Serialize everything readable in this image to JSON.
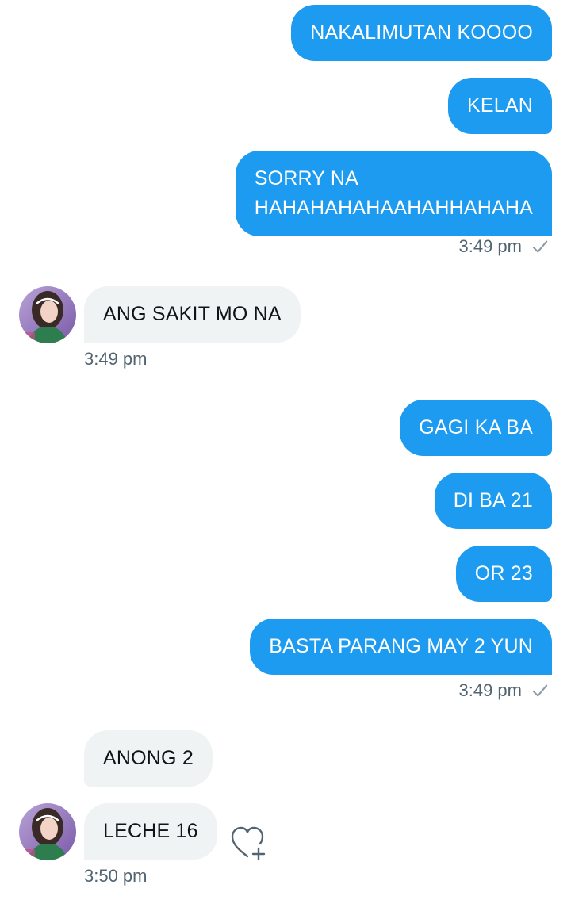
{
  "conversation": {
    "sent_group_1": {
      "messages": [
        "NAKALIMUTAN KOOOO",
        "KELAN",
        "SORRY NA",
        "HAHAHAHAHAAHAHHAHAHA"
      ],
      "timestamp": "3:49 pm",
      "status_icon": "check-icon"
    },
    "recv_group_1": {
      "messages": [
        "ANG SAKIT MO NA"
      ],
      "timestamp": "3:49 pm",
      "avatar_icon": "contact-avatar"
    },
    "sent_group_2": {
      "messages": [
        "GAGI KA BA",
        "DI BA 21",
        "OR 23",
        "BASTA PARANG MAY 2 YUN"
      ],
      "timestamp": "3:49 pm",
      "status_icon": "check-icon"
    },
    "recv_group_2": {
      "messages": [
        "ANONG 2",
        "LECHE 16"
      ],
      "timestamp": "3:50 pm",
      "avatar_icon": "contact-avatar",
      "reaction_icon": "add-reaction-heart-icon"
    }
  },
  "colors": {
    "sent_bubble": "#1d9bf0",
    "received_bubble": "#eff3f4",
    "meta_text": "#536471"
  }
}
